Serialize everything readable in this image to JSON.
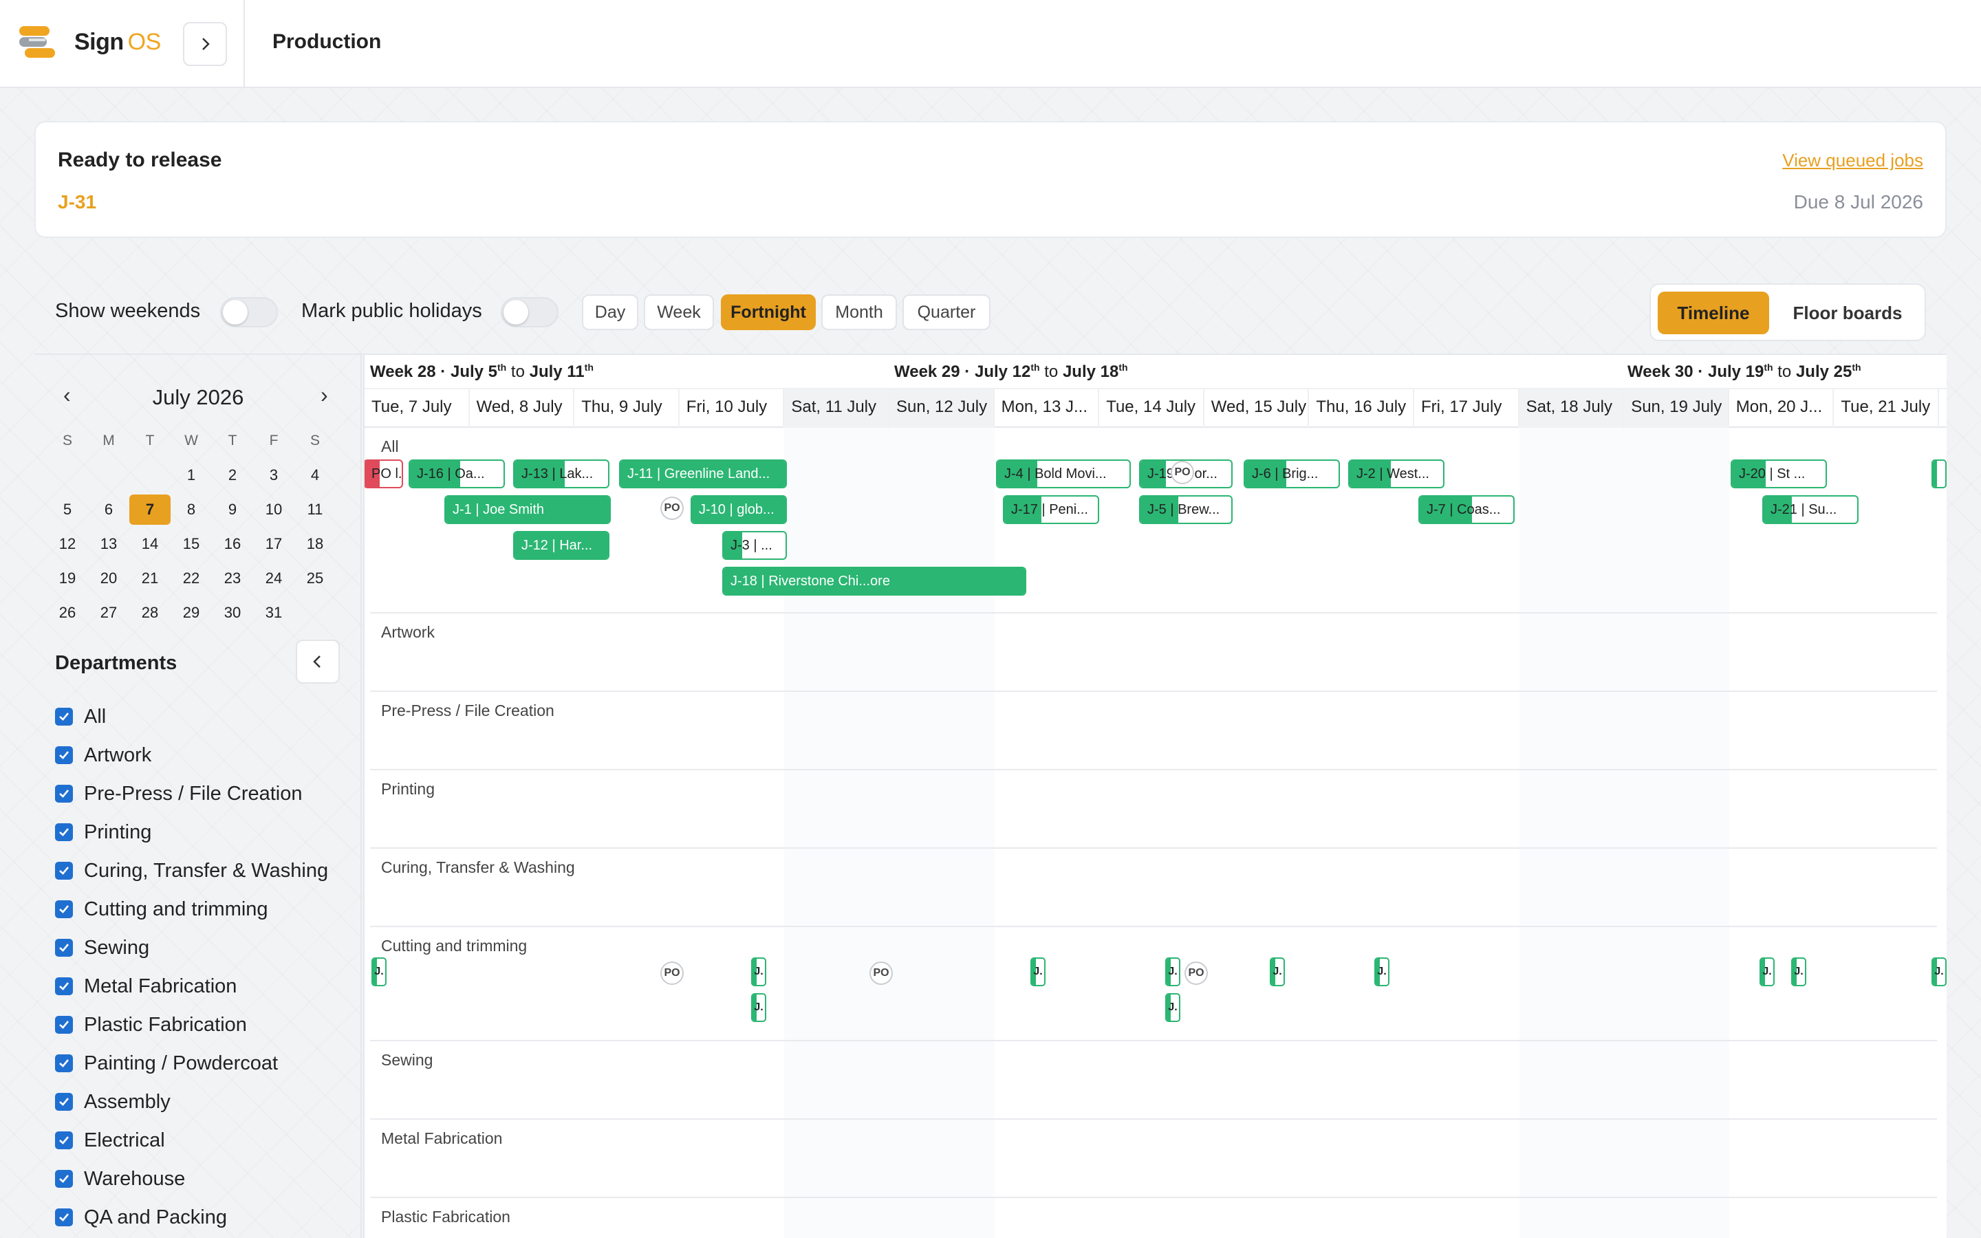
{
  "header": {
    "brand_main": "Sign",
    "brand_accent": "OS",
    "page_title": "Production"
  },
  "release": {
    "heading": "Ready to release",
    "job": "J-31",
    "link": "View queued jobs",
    "due": "Due 8 Jul 2026"
  },
  "toolbar": {
    "show_weekends": "Show weekends",
    "mark_holidays": "Mark public holidays",
    "views": [
      "Day",
      "Week",
      "Fortnight",
      "Month",
      "Quarter"
    ],
    "active_view": "Fortnight",
    "modes": [
      "Timeline",
      "Floor boards"
    ],
    "active_mode": "Timeline"
  },
  "calendar": {
    "month": "July 2026",
    "prev": "‹",
    "next": "›",
    "dow": [
      "S",
      "M",
      "T",
      "W",
      "T",
      "F",
      "S"
    ],
    "weeks": [
      [
        "",
        "",
        "",
        "1",
        "2",
        "3",
        "4"
      ],
      [
        "5",
        "6",
        "7",
        "8",
        "9",
        "10",
        "11"
      ],
      [
        "12",
        "13",
        "14",
        "15",
        "16",
        "17",
        "18"
      ],
      [
        "19",
        "20",
        "21",
        "22",
        "23",
        "24",
        "25"
      ],
      [
        "26",
        "27",
        "28",
        "29",
        "30",
        "31",
        ""
      ]
    ],
    "today": "7"
  },
  "departments": {
    "heading": "Departments",
    "items": [
      "All",
      "Artwork",
      "Pre-Press / File Creation",
      "Printing",
      "Curing, Transfer & Washing",
      "Cutting and trimming",
      "Sewing",
      "Metal Fabrication",
      "Plastic Fabrication",
      "Painting / Powdercoat",
      "Assembly",
      "Electrical",
      "Warehouse",
      "QA and Packing"
    ]
  },
  "timeline": {
    "weeks": [
      {
        "label": "Week 28",
        "from": "July 5",
        "to": "July 11"
      },
      {
        "label": "Week 29",
        "from": "July 12",
        "to": "July 18"
      },
      {
        "label": "Week 30",
        "from": "July 19",
        "to": "July 25"
      }
    ],
    "week_sep": "·",
    "to_word": "to",
    "ord": "th",
    "days": [
      "Tue, 7 July",
      "Wed, 8 July",
      "Thu, 9 July",
      "Fri, 10 July",
      "Sat, 11 July",
      "Sun, 12 July",
      "Mon, 13 J...",
      "Tue, 14 July",
      "Wed, 15 July",
      "Thu, 16 July",
      "Fri, 17 July",
      "Sat, 18 July",
      "Sun, 19 July",
      "Mon, 20 J...",
      "Tue, 21 July"
    ],
    "lanes": [
      "All",
      "Artwork",
      "Pre-Press / File Creation",
      "Printing",
      "Curing, Transfer & Washing",
      "Cutting and trimming",
      "Sewing",
      "Metal Fabrication",
      "Plastic Fabrication"
    ],
    "jobs_all": [
      {
        "id": "j16",
        "text": "J-16 | Oa..."
      },
      {
        "id": "j13",
        "text": "J-13 | Lak..."
      },
      {
        "id": "j11",
        "text": "J-11 | Greenline Land..."
      },
      {
        "id": "j4",
        "text": "J-4 | Bold Movi..."
      },
      {
        "id": "j19",
        "text": "J-19 | Por..."
      },
      {
        "id": "j6",
        "text": "J-6 | Brig..."
      },
      {
        "id": "j2",
        "text": "J-2 | West..."
      },
      {
        "id": "j20",
        "text": "J-20 | St ..."
      },
      {
        "id": "j1",
        "text": "J-1 | Joe Smith"
      },
      {
        "id": "j10",
        "text": "J-10 | glob..."
      },
      {
        "id": "j17",
        "text": "J-17 | Peni..."
      },
      {
        "id": "j5",
        "text": "J-5 | Brew..."
      },
      {
        "id": "j7",
        "text": "J-7 | Coas..."
      },
      {
        "id": "j21",
        "text": "J-21 | Su..."
      },
      {
        "id": "j12",
        "text": "J-12 | Har..."
      },
      {
        "id": "j3",
        "text": "J-3 | ..."
      },
      {
        "id": "j18",
        "text": "J-18 | Riverstone Chi...ore"
      },
      {
        "id": "j0",
        "text": "PO l..."
      }
    ],
    "po_label": "PO",
    "mini_label": "J."
  },
  "colors": {
    "accent": "#e8a020",
    "job_green": "#2bb673",
    "checkbox": "#1f6fd1"
  }
}
